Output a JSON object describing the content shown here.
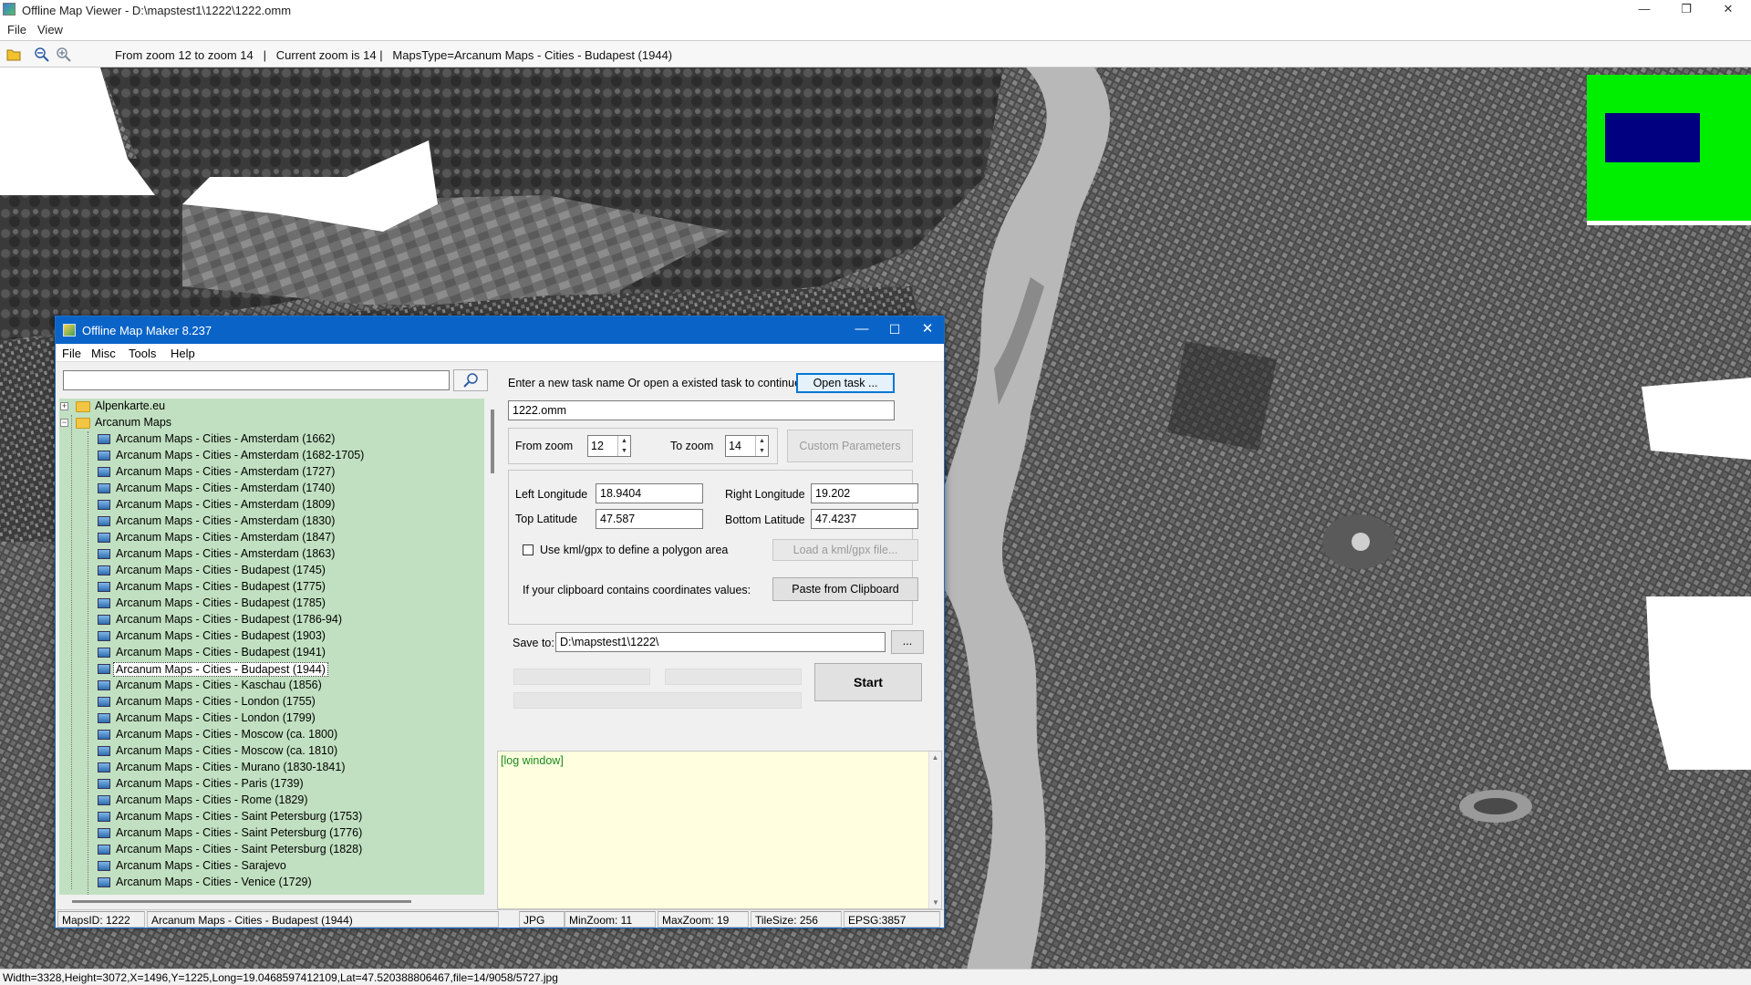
{
  "window": {
    "title": "Offline Map Viewer - D:\\mapstest1\\1222\\1222.omm",
    "minimize": "—",
    "restore": "❐",
    "close": "✕"
  },
  "menu": {
    "file": "File",
    "view": "View"
  },
  "toolbar": {
    "info": "From zoom 12 to zoom 14   |   Current zoom is 14 |   MapsType=Arcanum Maps - Cities - Budapest (1944)"
  },
  "status": {
    "text": "Width=3328,Height=3072,X=1496,Y=1225,Long=19.0468597412109,Lat=47.520388806467,file=14/9058/5727.jpg"
  },
  "minimap": {
    "background": "#00ee00",
    "view_color": "#000080"
  },
  "dialog": {
    "title": "Offline Map Maker 8.237",
    "menu": {
      "file": "File",
      "misc": "Misc",
      "tools": "Tools",
      "help": "Help"
    },
    "search": {
      "value": "",
      "icon": "search-icon"
    },
    "tree": {
      "roots": [
        {
          "label": "Alpenkarte.eu",
          "expanded": false
        },
        {
          "label": "Arcanum Maps",
          "expanded": true
        }
      ],
      "items": [
        "Arcanum Maps - Cities - Amsterdam (1662)",
        "Arcanum Maps - Cities - Amsterdam (1682-1705)",
        "Arcanum Maps - Cities - Amsterdam (1727)",
        "Arcanum Maps - Cities - Amsterdam (1740)",
        "Arcanum Maps - Cities - Amsterdam (1809)",
        "Arcanum Maps - Cities - Amsterdam (1830)",
        "Arcanum Maps - Cities - Amsterdam (1847)",
        "Arcanum Maps - Cities - Amsterdam (1863)",
        "Arcanum Maps - Cities - Budapest (1745)",
        "Arcanum Maps - Cities - Budapest (1775)",
        "Arcanum Maps - Cities - Budapest (1785)",
        "Arcanum Maps - Cities - Budapest (1786-94)",
        "Arcanum Maps - Cities - Budapest (1903)",
        "Arcanum Maps - Cities - Budapest (1941)",
        "Arcanum Maps - Cities - Budapest (1944)",
        "Arcanum Maps - Cities - Kaschau (1856)",
        "Arcanum Maps - Cities - London (1755)",
        "Arcanum Maps - Cities - London (1799)",
        "Arcanum Maps - Cities - Moscow (ca. 1800)",
        "Arcanum Maps - Cities - Moscow (ca. 1810)",
        "Arcanum Maps - Cities - Murano (1830-1841)",
        "Arcanum Maps - Cities - Paris (1739)",
        "Arcanum Maps - Cities - Rome (1829)",
        "Arcanum Maps - Cities - Saint Petersburg (1753)",
        "Arcanum Maps - Cities - Saint Petersburg (1776)",
        "Arcanum Maps - Cities - Saint Petersburg (1828)",
        "Arcanum Maps - Cities - Sarajevo",
        "Arcanum Maps - Cities - Venice (1729)"
      ],
      "selected": "Arcanum Maps - Cities - Budapest (1944)"
    },
    "task_prompt": "Enter a new task name Or open a existed task to continue:",
    "open_task": "Open task ...",
    "task_name": "1222.omm",
    "from_zoom_label": "From zoom",
    "from_zoom": "12",
    "to_zoom_label": "To zoom",
    "to_zoom": "14",
    "custom_params": "Custom Parameters",
    "left_lon_label": "Left Longitude",
    "left_lon": "18.9404",
    "right_lon_label": "Right Longitude",
    "right_lon": "19.202",
    "top_lat_label": "Top Latitude",
    "top_lat": "47.587",
    "bottom_lat_label": "Bottom Latitude",
    "bottom_lat": "47.4237",
    "kml_label": "Use kml/gpx to define a polygon area",
    "kml_checked": false,
    "load_kml": "Load a kml/gpx file...",
    "clipboard_label": "If your clipboard contains coordinates values:",
    "paste": "Paste from Clipboard",
    "save_label": "Save to:",
    "save_path": "D:\\mapstest1\\1222\\",
    "browse": "...",
    "start": "Start",
    "log": "[log window]",
    "log_color": "#1a8a1a",
    "log_bg": "#ffffe0",
    "statusbar": {
      "maps_id": "MapsID: 1222",
      "maps_name": "Arcanum Maps - Cities - Budapest (1944)",
      "format": "JPG",
      "min_zoom": "MinZoom: 11",
      "max_zoom": "MaxZoom: 19",
      "tile_size": "TileSize: 256",
      "epsg": "EPSG:3857"
    }
  }
}
